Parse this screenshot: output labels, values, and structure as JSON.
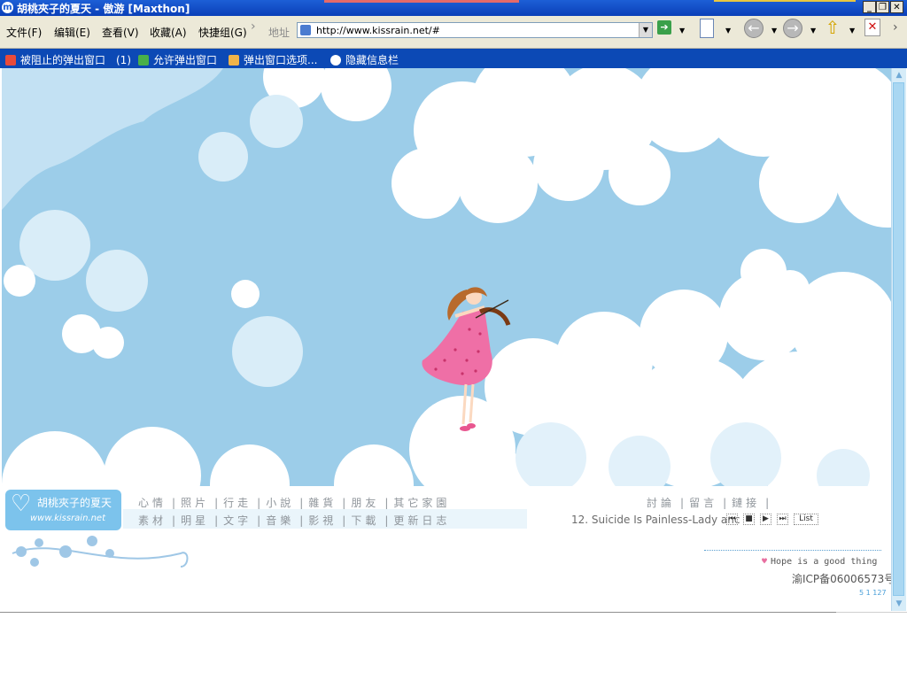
{
  "window": {
    "title": "胡桃夾子的夏天 - 傲游 [Maxthon]",
    "app_icon_letter": "m",
    "controls": {
      "minimize": "_",
      "restore": "❐",
      "close": "✕"
    }
  },
  "menubar": {
    "items": [
      "文件(F)",
      "编辑(E)",
      "查看(V)",
      "收藏(A)",
      "快捷组(G)"
    ],
    "address_label": "地址",
    "url": "http://www.kissrain.net/#"
  },
  "infobar": {
    "blocked": "被阻止的弹出窗口　(1)",
    "allow": "允许弹出窗口",
    "options": "弹出窗口选项...",
    "hide": "隐藏信息栏"
  },
  "site": {
    "logo_name": "胡桃夾子的夏天",
    "logo_url": "www.kissrain.net",
    "nav_row1": [
      "心情",
      "照片",
      "行走",
      "小說",
      "雜貨",
      "朋友",
      "其它家園"
    ],
    "nav_row2": [
      "素材",
      "明星",
      "文字",
      "音樂",
      "影視",
      "下載",
      "更新日志"
    ],
    "nav_right": [
      "討論",
      "留言",
      "鏈接"
    ],
    "now_playing": "12. Suicide Is Painless-Lady anc",
    "player_list": "List",
    "motto": "Hope is a good thing",
    "icp": "渝ICP备06006573号",
    "counter": "5 1 127"
  },
  "colors": {
    "sky": "#a9d4ef",
    "cloud": "#ffffff",
    "titlebar": "#0a3fb8",
    "infobar": "#0c49b5",
    "logo_bg": "#7cc3ec",
    "dress": "#ef6fa6"
  }
}
